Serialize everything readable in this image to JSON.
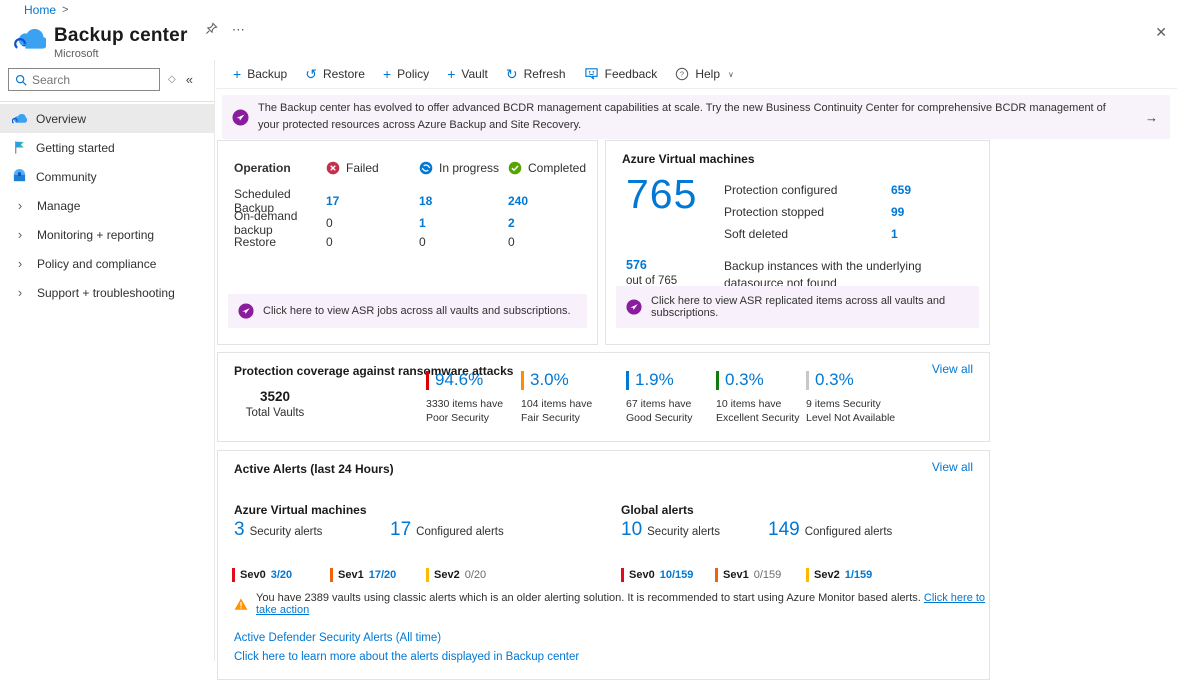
{
  "glyphs": {
    "breadcrumb_sep": ">",
    "close": "✕",
    "ellipsis": "⋯",
    "collapse": "«",
    "diamond": "◇",
    "plus": "+",
    "restore": "↺",
    "refresh": "↻",
    "help_chevron": "∨",
    "arrow_right": "→",
    "side_chevron": "›"
  },
  "colors": {
    "accent": "#0078d4",
    "purple": "#8a1c9e",
    "failed_red": "#c4314b",
    "success_green": "#57a300",
    "warning_orange": "#ff9300"
  },
  "breadcrumb": {
    "home": "Home"
  },
  "header": {
    "title": "Backup center",
    "subtitle": "Microsoft"
  },
  "sidebar": {
    "search": {
      "placeholder": "Search"
    },
    "items": [
      {
        "label": "Overview"
      },
      {
        "label": "Getting started"
      },
      {
        "label": "Community"
      },
      {
        "label": "Manage"
      },
      {
        "label": "Monitoring + reporting"
      },
      {
        "label": "Policy and compliance"
      },
      {
        "label": "Support + troubleshooting"
      }
    ]
  },
  "toolbar": {
    "backup": "Backup",
    "restore": "Restore",
    "policy": "Policy",
    "vault": "Vault",
    "refresh": "Refresh",
    "feedback": "Feedback",
    "help": "Help"
  },
  "banner": {
    "text": "The Backup center has evolved to offer advanced BCDR management capabilities at scale. Try the new Business Continuity Center for comprehensive BCDR management of your protected resources across Azure Backup and Site Recovery."
  },
  "jobs": {
    "columns": {
      "operation": "Operation",
      "failed": "Failed",
      "in_progress": "In progress",
      "completed": "Completed"
    },
    "rows": [
      {
        "operation": "Scheduled Backup",
        "failed": "17",
        "in_progress": "18",
        "completed": "240"
      },
      {
        "operation": "On-demand backup",
        "failed": "0",
        "in_progress": "1",
        "completed": "2"
      },
      {
        "operation": "Restore",
        "failed": "0",
        "in_progress": "0",
        "completed": "0"
      }
    ],
    "asr_notice": "Click here to view ASR jobs across all vaults and subscriptions."
  },
  "vm_card": {
    "title": "Azure Virtual machines",
    "total": "765",
    "stats": [
      {
        "label": "Protection configured",
        "value": "659"
      },
      {
        "label": "Protection stopped",
        "value": "99"
      },
      {
        "label": "Soft deleted",
        "value": "1"
      }
    ],
    "datasource": {
      "value": "576",
      "of": "out of 765",
      "label": "Backup instances with the underlying datasource not found"
    },
    "asr_notice": "Click here to view ASR replicated items across all vaults and subscriptions."
  },
  "ransomware": {
    "title": "Protection coverage against ransomware attacks",
    "view_all": "View all",
    "total": {
      "value": "3520",
      "label": "Total Vaults"
    },
    "stats": [
      {
        "percent": "94.6%",
        "label": "3330 items have Poor Security",
        "color": "#dd0000"
      },
      {
        "percent": "3.0%",
        "label": "104 items have Fair Security",
        "color": "#ff8c00"
      },
      {
        "percent": "1.9%",
        "label": "67 items have Good Security",
        "color": "#0078d4"
      },
      {
        "percent": "0.3%",
        "label": "10 items have Excellent Security",
        "color": "#107c10"
      },
      {
        "percent": "0.3%",
        "label": "9 items Security Level Not Available",
        "color": "#c8c8c8"
      }
    ]
  },
  "alerts": {
    "title": "Active Alerts (last 24 Hours)",
    "view_all": "View all",
    "groups": [
      {
        "title": "Azure Virtual machines",
        "counts": [
          {
            "value": "3",
            "label": "Security alerts"
          },
          {
            "value": "17",
            "label": "Configured alerts"
          }
        ],
        "severities": [
          {
            "name": "Sev0",
            "value": "3/20",
            "color": "#e00b1c"
          },
          {
            "name": "Sev1",
            "value": "17/20",
            "color": "#f2610c"
          },
          {
            "name": "Sev2",
            "value": "0/20",
            "color": "#ffb900"
          }
        ]
      },
      {
        "title": "Global alerts",
        "counts": [
          {
            "value": "10",
            "label": "Security alerts"
          },
          {
            "value": "149",
            "label": "Configured alerts"
          }
        ],
        "severities": [
          {
            "name": "Sev0",
            "value": "10/159",
            "color": "#e00b1c"
          },
          {
            "name": "Sev1",
            "value": "0/159",
            "color": "#f2610c"
          },
          {
            "name": "Sev2",
            "value": "1/159",
            "color": "#ffb900"
          }
        ]
      }
    ],
    "warning": {
      "text": "You have 2389 vaults using classic alerts which is an older alerting solution. It is recommended to start using Azure Monitor based alerts.",
      "link": "Click here to take action"
    },
    "links": [
      "Active Defender Security Alerts (All time)",
      "Click here to learn more about the alerts displayed in Backup center"
    ]
  }
}
